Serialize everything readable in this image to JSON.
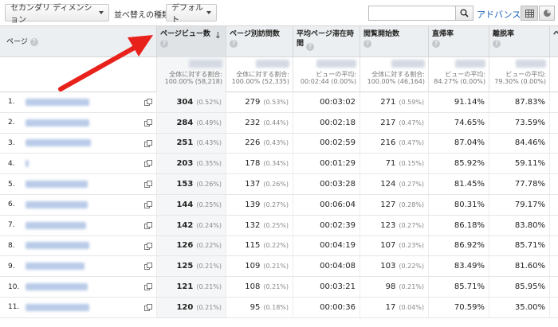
{
  "toolbar": {
    "secondary_dimension": "セカンダリ ディメンション",
    "sort_label": "並べ替えの種類:",
    "sort_value": "デフォルト",
    "search_placeholder": "",
    "advanced": "アドバンス"
  },
  "columns": {
    "page": "ページ",
    "pageviews": "ページビュー数",
    "unique": "ページ別訪問数",
    "avg_time": "平均ページ滞在時間",
    "entrances": "閲覧開始数",
    "bounce": "直帰率",
    "exit": "離脱率",
    "extra": "ペ"
  },
  "totals": {
    "pageviews": {
      "label": "全体に対する割合:",
      "value": "100.00% (58,218)"
    },
    "unique": {
      "label": "全体に対する割合:",
      "value": "100.00% (52,335)"
    },
    "avg_time": {
      "label": "ビューの平均:",
      "value": "00:02:44 (0.00%)"
    },
    "entrances": {
      "label": "全体に対する割合:",
      "value": "100.00% (46,164)"
    },
    "bounce": {
      "label": "ビューの平均:",
      "value": "84.27% (0.00%)"
    },
    "exit": {
      "label": "ビューの平均:",
      "value": "79.30% (0.00%)"
    }
  },
  "rows": [
    {
      "n": "1.",
      "pv": "304",
      "pv_pct": "(0.52%)",
      "u": "279",
      "u_pct": "(0.53%)",
      "t": "00:03:02",
      "e": "271",
      "e_pct": "(0.59%)",
      "b": "91.14%",
      "x": "87.83%"
    },
    {
      "n": "2.",
      "pv": "284",
      "pv_pct": "(0.49%)",
      "u": "232",
      "u_pct": "(0.44%)",
      "t": "00:02:18",
      "e": "217",
      "e_pct": "(0.47%)",
      "b": "74.65%",
      "x": "73.59%"
    },
    {
      "n": "3.",
      "pv": "251",
      "pv_pct": "(0.43%)",
      "u": "226",
      "u_pct": "(0.43%)",
      "t": "00:02:59",
      "e": "216",
      "e_pct": "(0.47%)",
      "b": "87.04%",
      "x": "84.46%"
    },
    {
      "n": "4.",
      "pv": "203",
      "pv_pct": "(0.35%)",
      "u": "178",
      "u_pct": "(0.34%)",
      "t": "00:01:29",
      "e": "71",
      "e_pct": "(0.15%)",
      "b": "85.92%",
      "x": "59.11%"
    },
    {
      "n": "5.",
      "pv": "153",
      "pv_pct": "(0.26%)",
      "u": "137",
      "u_pct": "(0.26%)",
      "t": "00:03:28",
      "e": "124",
      "e_pct": "(0.27%)",
      "b": "81.45%",
      "x": "77.78%"
    },
    {
      "n": "6.",
      "pv": "144",
      "pv_pct": "(0.25%)",
      "u": "139",
      "u_pct": "(0.27%)",
      "t": "00:06:04",
      "e": "127",
      "e_pct": "(0.28%)",
      "b": "80.31%",
      "x": "79.17%"
    },
    {
      "n": "7.",
      "pv": "142",
      "pv_pct": "(0.24%)",
      "u": "132",
      "u_pct": "(0.25%)",
      "t": "00:02:39",
      "e": "123",
      "e_pct": "(0.27%)",
      "b": "86.18%",
      "x": "83.80%"
    },
    {
      "n": "8.",
      "pv": "126",
      "pv_pct": "(0.22%)",
      "u": "115",
      "u_pct": "(0.22%)",
      "t": "00:04:19",
      "e": "107",
      "e_pct": "(0.23%)",
      "b": "86.92%",
      "x": "85.71%"
    },
    {
      "n": "9.",
      "pv": "125",
      "pv_pct": "(0.21%)",
      "u": "109",
      "u_pct": "(0.21%)",
      "t": "00:04:08",
      "e": "103",
      "e_pct": "(0.22%)",
      "b": "83.49%",
      "x": "81.60%"
    },
    {
      "n": "10.",
      "pv": "121",
      "pv_pct": "(0.21%)",
      "u": "108",
      "u_pct": "(0.21%)",
      "t": "00:03:21",
      "e": "98",
      "e_pct": "(0.21%)",
      "b": "85.71%",
      "x": "85.95%"
    },
    {
      "n": "11.",
      "pv": "120",
      "pv_pct": "(0.21%)",
      "u": "95",
      "u_pct": "(0.18%)",
      "t": "00:00:36",
      "e": "17",
      "e_pct": "(0.04%)",
      "b": "70.59%",
      "x": "35.00%"
    }
  ],
  "colors": {
    "arrow": "#e8211b",
    "link": "#1a5fb4",
    "header_bg": "#eceff1"
  },
  "icons": [
    "chevron-down-icon",
    "search-icon",
    "grid-view-icon",
    "pie-view-icon",
    "help-icon",
    "sort-down-icon",
    "copy-link-icon"
  ]
}
